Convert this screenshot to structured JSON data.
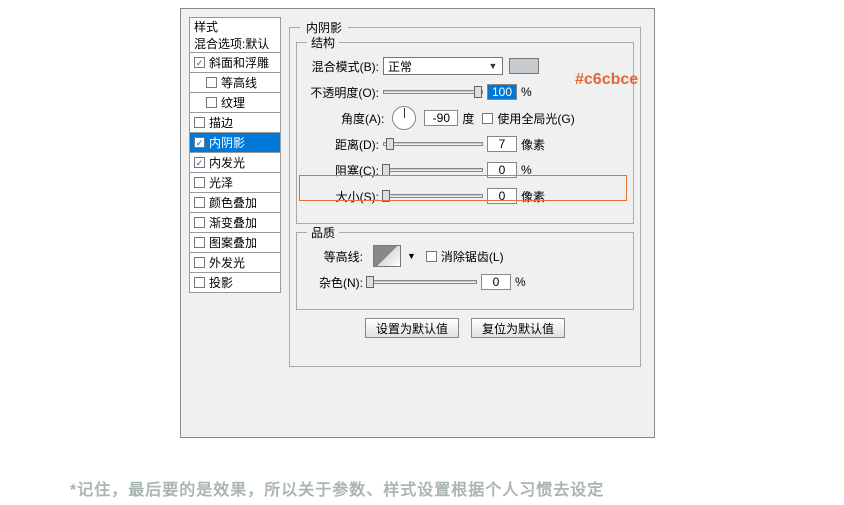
{
  "sidebar": {
    "head1": "样式",
    "head2": "混合选项:默认",
    "items": [
      {
        "label": "斜面和浮雕",
        "checked": true,
        "indent": false
      },
      {
        "label": "等高线",
        "checked": false,
        "indent": true
      },
      {
        "label": "纹理",
        "checked": false,
        "indent": true
      },
      {
        "label": "描边",
        "checked": false,
        "indent": false
      },
      {
        "label": "内阴影",
        "checked": true,
        "indent": false,
        "selected": true
      },
      {
        "label": "内发光",
        "checked": true,
        "indent": false
      },
      {
        "label": "光泽",
        "checked": false,
        "indent": false
      },
      {
        "label": "颜色叠加",
        "checked": false,
        "indent": false
      },
      {
        "label": "渐变叠加",
        "checked": false,
        "indent": false
      },
      {
        "label": "图案叠加",
        "checked": false,
        "indent": false
      },
      {
        "label": "外发光",
        "checked": false,
        "indent": false
      },
      {
        "label": "投影",
        "checked": false,
        "indent": false
      }
    ]
  },
  "panel": {
    "title": "内阴影",
    "group1_title": "结构",
    "blend_mode_label": "混合模式(B):",
    "blend_mode_value": "正常",
    "opacity_label": "不透明度(O):",
    "opacity_value": "100",
    "opacity_unit": "%",
    "angle_label": "角度(A):",
    "angle_value": "-90",
    "angle_unit": "度",
    "global_label": "使用全局光(G)",
    "distance_label": "距离(D):",
    "distance_value": "7",
    "distance_unit": "像素",
    "choke_label": "阻塞(C):",
    "choke_value": "0",
    "choke_unit": "%",
    "size_label": "大小(S):",
    "size_value": "0",
    "size_unit": "像素",
    "group2_title": "品质",
    "contour_label": "等高线:",
    "anti_alias_label": "消除锯齿(L)",
    "noise_label": "杂色(N):",
    "noise_value": "0",
    "noise_unit": "%",
    "btn_default": "设置为默认值",
    "btn_reset": "复位为默认值"
  },
  "annotation": {
    "hex": "#c6cbce"
  },
  "footnote": "*记住，最后要的是效果，所以关于参数、样式设置根据个人习惯去设定"
}
